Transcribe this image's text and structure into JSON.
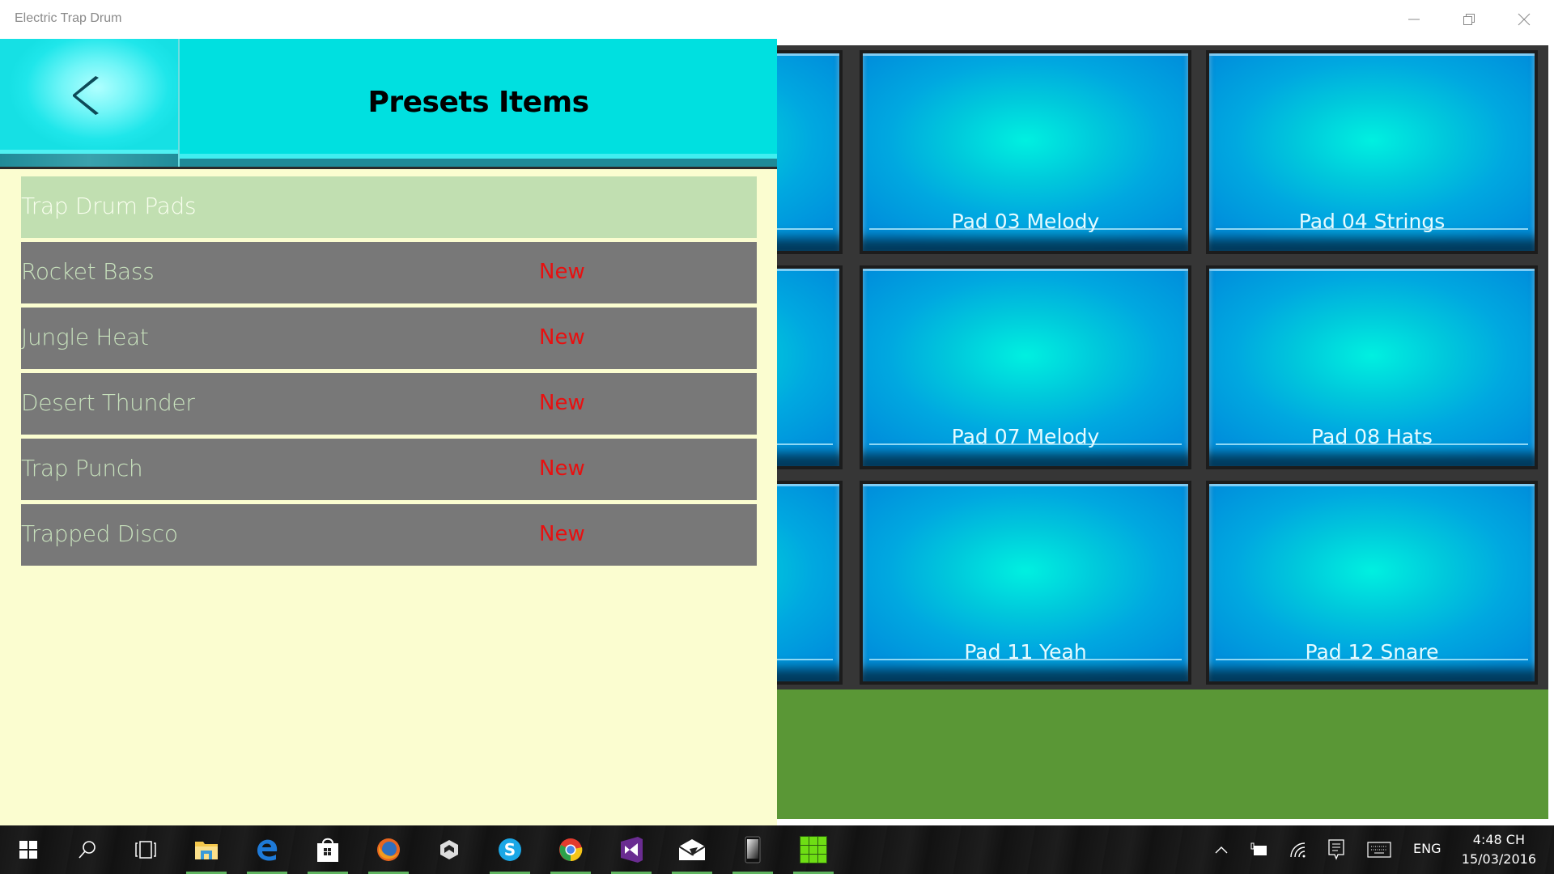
{
  "window": {
    "title": "Electric Trap Drum",
    "controls": [
      "minimize",
      "restore",
      "close"
    ]
  },
  "header": {
    "back_icon": "chevron-left-icon",
    "title": "Presets Items"
  },
  "presets": {
    "items": [
      {
        "name": "Trap Drum Pads",
        "badge": "",
        "selected": true
      },
      {
        "name": "Rocket Bass",
        "badge": "New",
        "selected": false
      },
      {
        "name": "Jungle Heat",
        "badge": "New",
        "selected": false
      },
      {
        "name": "Desert Thunder",
        "badge": "New",
        "selected": false
      },
      {
        "name": "Trap Punch",
        "badge": "New",
        "selected": false
      },
      {
        "name": "Trapped Disco",
        "badge": "New",
        "selected": false
      }
    ]
  },
  "pads": {
    "rows": [
      [
        {
          "label": ""
        },
        {
          "label": "Pad 03 Melody"
        },
        {
          "label": "Pad 04 Strings"
        }
      ],
      [
        {
          "label": ""
        },
        {
          "label": "Pad 07 Melody"
        },
        {
          "label": "Pad 08 Hats"
        }
      ],
      [
        {
          "label": ""
        },
        {
          "label": "Pad 11 Yeah"
        },
        {
          "label": "Pad 12 Snare"
        }
      ]
    ]
  },
  "colors": {
    "header_accent": "#00e0e0",
    "panel_bg": "#fbfdd0",
    "selected_row": "#c1dfb1",
    "row_bg": "#787878",
    "badge_text": "#e81010",
    "green_area": "#5a9736"
  },
  "taskbar": {
    "apps": [
      {
        "name": "start",
        "icon": "windows-start-icon",
        "running": false
      },
      {
        "name": "search",
        "icon": "search-icon",
        "running": false
      },
      {
        "name": "task-view",
        "icon": "task-view-icon",
        "running": false
      },
      {
        "name": "file-explorer",
        "icon": "folder-icon",
        "running": true
      },
      {
        "name": "edge",
        "icon": "edge-browser-icon",
        "running": true
      },
      {
        "name": "store",
        "icon": "store-bag-icon",
        "running": true
      },
      {
        "name": "firefox",
        "icon": "firefox-icon",
        "running": true
      },
      {
        "name": "unity",
        "icon": "unity-icon",
        "running": false
      },
      {
        "name": "skype",
        "icon": "skype-icon",
        "running": true
      },
      {
        "name": "chrome",
        "icon": "chrome-icon",
        "running": true
      },
      {
        "name": "visual-studio",
        "icon": "visual-studio-icon",
        "running": true
      },
      {
        "name": "mail",
        "icon": "mail-icon",
        "running": true
      },
      {
        "name": "phone",
        "icon": "phone-icon",
        "running": true
      },
      {
        "name": "drum-pads-app",
        "icon": "green-grid-icon",
        "running": true
      }
    ],
    "tray": {
      "language": "ENG",
      "time": "4:48 CH",
      "date": "15/03/2016"
    }
  }
}
